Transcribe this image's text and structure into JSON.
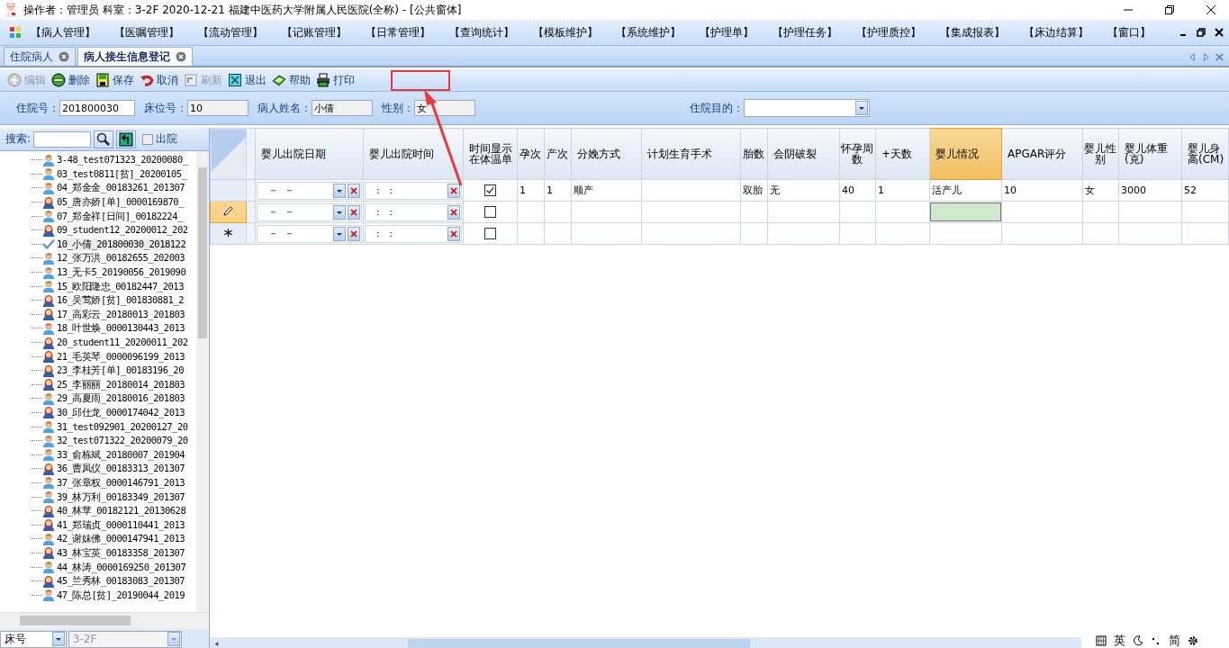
{
  "window": {
    "title": "操作者：管理员  科室：3-2F  2020-12-21  福建中医药大学附属人民医院(全称) - [公共窗体]"
  },
  "menu": [
    "【病人管理】",
    "【医嘱管理】",
    "【流动管理】",
    "【记账管理】",
    "【日常管理】",
    "【查询统计】",
    "【模板维护】",
    "【系统维护】",
    "【护理单】",
    "【护理任务】",
    "【护理质控】",
    "【集成报表】",
    "【床边结算】",
    "【窗口】"
  ],
  "tabs": [
    {
      "label": "住院病人",
      "selected": false
    },
    {
      "label": "病人接生信息登记",
      "selected": true
    }
  ],
  "toolbar": [
    {
      "label": "编辑",
      "kind": "plus",
      "disabled": true
    },
    {
      "label": "删除",
      "kind": "minus",
      "disabled": false
    },
    {
      "label": "保存",
      "kind": "save",
      "disabled": false
    },
    {
      "label": "取消",
      "kind": "undo",
      "disabled": false
    },
    {
      "label": "刷新",
      "kind": "refresh",
      "disabled": true
    },
    {
      "label": "退出",
      "kind": "exit",
      "disabled": false
    },
    {
      "label": "帮助",
      "kind": "help",
      "disabled": false
    },
    {
      "label": "打印",
      "kind": "print",
      "disabled": false
    }
  ],
  "form": {
    "fields": [
      {
        "label": "住院号：",
        "value": "201800030",
        "readonly": false
      },
      {
        "label": "床位号：",
        "value": "10",
        "readonly": true
      },
      {
        "label": "病人姓名：",
        "value": "小倩",
        "readonly": true
      },
      {
        "label": "性别：",
        "value": "女",
        "readonly": true
      }
    ],
    "purpose_label": "住院目的："
  },
  "search": {
    "label": "搜索:",
    "discharged": {
      "label": "出院",
      "checked": false
    }
  },
  "tree": [
    {
      "label": "3-48_test071323_20200080_",
      "kind": "male",
      "selected": false
    },
    {
      "label": "03_test0811[贫]_20200105_",
      "kind": "male",
      "selected": false
    },
    {
      "label": "04_郑金金_00183261_201307",
      "kind": "male",
      "selected": false
    },
    {
      "label": "05_唐亦娇[单]_0000169870_",
      "kind": "female",
      "selected": false
    },
    {
      "label": "07_郑金祥[日间]_00182224_",
      "kind": "male",
      "selected": false
    },
    {
      "label": "09_student12_20200012_202",
      "kind": "female",
      "selected": false
    },
    {
      "label": "10_小倩_201800030_2018122",
      "kind": "checked",
      "selected": true
    },
    {
      "label": "12_张万洪_00182655_202003",
      "kind": "male",
      "selected": false
    },
    {
      "label": "13_无卡5_20190056_2019090",
      "kind": "male",
      "selected": false
    },
    {
      "label": "15_欧阳隆忠_00182447_2013",
      "kind": "male",
      "selected": false
    },
    {
      "label": "16_吴莺娇[贫]_001830881_2",
      "kind": "female",
      "selected": false
    },
    {
      "label": "17_高彩云_20180013_201803",
      "kind": "female",
      "selected": false
    },
    {
      "label": "18_叶世焕_0000130443_2013",
      "kind": "male",
      "selected": false
    },
    {
      "label": "20_student11_20200011_202",
      "kind": "female",
      "selected": false
    },
    {
      "label": "21_毛英琴_0000096199_2013",
      "kind": "female",
      "selected": false
    },
    {
      "label": "23_李桂芳[单]_00183196_20",
      "kind": "female",
      "selected": false
    },
    {
      "label": "25_李丽丽_20180014_201803",
      "kind": "female",
      "selected": false
    },
    {
      "label": "29_高夏雨_20180016_201803",
      "kind": "male",
      "selected": false
    },
    {
      "label": "30_邱仕龙_0000174042_2013",
      "kind": "female",
      "selected": false
    },
    {
      "label": "31_test092901_20200127_20",
      "kind": "male",
      "selected": false
    },
    {
      "label": "32_test071322_20200079_20",
      "kind": "male",
      "selected": false
    },
    {
      "label": "33_俞栋斌_20180007_201904",
      "kind": "male",
      "selected": false
    },
    {
      "label": "36_曹凤仪_00183313_201307",
      "kind": "female",
      "selected": false
    },
    {
      "label": "37_张章权_0000146791_2013",
      "kind": "male",
      "selected": false
    },
    {
      "label": "39_林万利_00183349_201307",
      "kind": "male",
      "selected": false
    },
    {
      "label": "40_林苹_00182121_20130628",
      "kind": "female",
      "selected": false
    },
    {
      "label": "41_郑瑞贞_0000110441_2013",
      "kind": "female",
      "selected": false
    },
    {
      "label": "42_谢妹佛_0000147941_2013",
      "kind": "male",
      "selected": false
    },
    {
      "label": "43_林宝英_00183358_201307",
      "kind": "female",
      "selected": false
    },
    {
      "label": "44_林涛_0000169250_201307",
      "kind": "male",
      "selected": false
    },
    {
      "label": "45_兰秀林_00183083_201307",
      "kind": "female",
      "selected": false
    },
    {
      "label": "47_陈总[贫]_20190044_2019",
      "kind": "male",
      "selected": false
    }
  ],
  "bottom": {
    "sort": "床号",
    "ward": "3-2F"
  },
  "grid": {
    "columns": [
      {
        "label": "婴儿出院日期",
        "selected": false
      },
      {
        "label": "婴儿出院时间",
        "selected": false
      },
      {
        "label": "时间显示在体温单",
        "selected": false
      },
      {
        "label": "孕次",
        "selected": false
      },
      {
        "label": "产次",
        "selected": false
      },
      {
        "label": "分娩方式",
        "selected": false
      },
      {
        "label": "计划生育手术",
        "selected": false
      },
      {
        "label": "胎数",
        "selected": false
      },
      {
        "label": "会阴破裂",
        "selected": false
      },
      {
        "label": "怀孕周数",
        "selected": false
      },
      {
        "label": "+天数",
        "selected": false
      },
      {
        "label": "婴儿情况",
        "selected": true
      },
      {
        "label": "APGAR评分",
        "selected": false
      },
      {
        "label": "婴儿性别",
        "selected": false
      },
      {
        "label": "婴儿体重(克)",
        "selected": false
      },
      {
        "label": "婴儿身高(CM)",
        "selected": false
      }
    ],
    "rows": [
      {
        "kind": "normal",
        "cells": [
          "－  －",
          ":   :",
          true,
          "1",
          "1",
          "顺产",
          "",
          "双胎",
          "无",
          "40",
          "1",
          "活产儿",
          "10",
          "女",
          "3000",
          "52"
        ]
      },
      {
        "kind": "editing",
        "cells": [
          "－  －",
          ":   :",
          false,
          "",
          "",
          "",
          "",
          "",
          "",
          "",
          "",
          "",
          "",
          "",
          "",
          ""
        ]
      },
      {
        "kind": "new",
        "cells": [
          "－  －",
          ":   :",
          false,
          "",
          "",
          "",
          "",
          "",
          "",
          "",
          "",
          "",
          "",
          "",
          "",
          ""
        ]
      }
    ]
  },
  "annotation": {
    "kind": "box-arrow"
  },
  "ime": [
    "英",
    "简"
  ]
}
